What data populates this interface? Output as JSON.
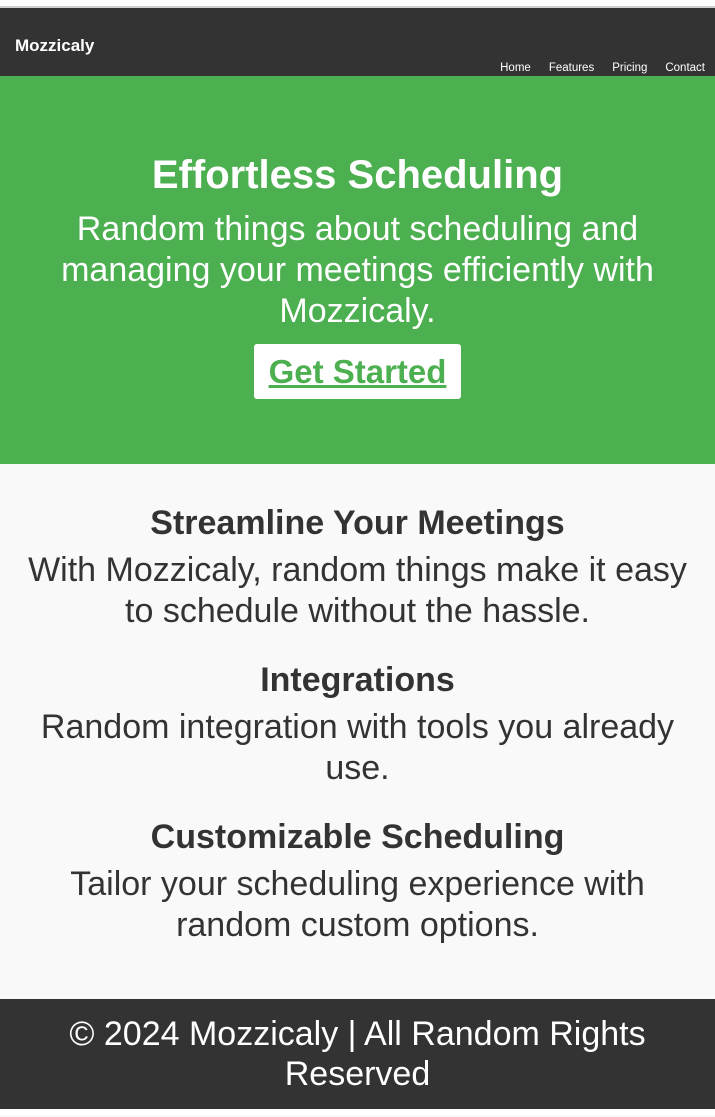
{
  "nav": {
    "brand": "Mozzicaly",
    "links": [
      "Home",
      "Features",
      "Pricing",
      "Contact"
    ]
  },
  "hero": {
    "title": "Effortless Scheduling",
    "subtitle": "Random things about scheduling and managing your meetings efficiently with Mozzicaly.",
    "cta_label": "Get Started"
  },
  "features": [
    {
      "title": "Streamline Your Meetings",
      "description": "With Mozzicaly, random things make it easy to schedule without the hassle."
    },
    {
      "title": "Integrations",
      "description": "Random integration with tools you already use."
    },
    {
      "title": "Customizable Scheduling",
      "description": "Tailor your scheduling experience with random custom options."
    }
  ],
  "footer": {
    "text": "© 2024 Mozzicaly | All Random Rights Reserved"
  },
  "colors": {
    "nav_bg": "#333333",
    "hero_bg": "#4caf50",
    "page_bg": "#f9f9f9",
    "text": "#333333",
    "cta_text": "#4caf50"
  }
}
